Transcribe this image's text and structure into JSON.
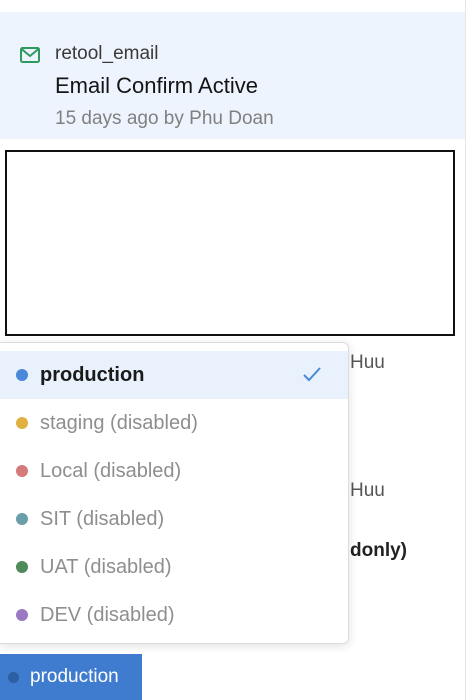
{
  "header": {
    "resource_icon": "envelope-icon",
    "resource_name": "retool_email",
    "query_title": "Email Confirm Active",
    "meta": "15 days ago by Phu Doan"
  },
  "background": {
    "author_fragment_1": "Huu",
    "author_fragment_2": "Huu",
    "readonly_fragment": "donly)"
  },
  "dropdown": {
    "options": [
      {
        "label": "production",
        "color": "#4a88da",
        "selected": true
      },
      {
        "label": "staging (disabled)",
        "color": "#e0b040",
        "selected": false
      },
      {
        "label": "Local (disabled)",
        "color": "#d47a7a",
        "selected": false
      },
      {
        "label": "SIT (disabled)",
        "color": "#6a9ea8",
        "selected": false
      },
      {
        "label": "UAT (disabled)",
        "color": "#4e8a5a",
        "selected": false
      },
      {
        "label": "DEV (disabled)",
        "color": "#9a78c2",
        "selected": false
      }
    ],
    "check_icon": "checkmark-icon"
  },
  "environment_button": {
    "label": "production",
    "color": "#3f7ccf"
  }
}
